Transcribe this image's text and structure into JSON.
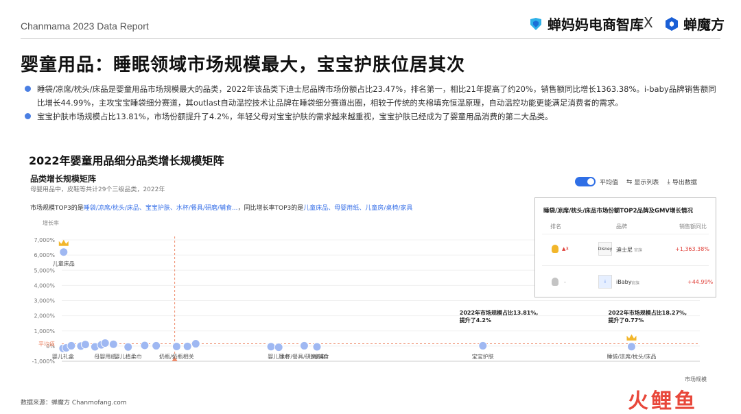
{
  "header": {
    "report_label": "Chanmama 2023 Data Report",
    "brand_left": "蝉妈妈电商智库",
    "brand_sep": "X",
    "brand_right": "蝉魔方"
  },
  "page_title": "婴童用品：睡眠领域市场规模最大，宝宝护肤位居其次",
  "bullets": [
    "睡袋/凉席/枕头/床品是婴童用品市场规模最大的品类，2022年该品类下迪士尼品牌市场份额占比23.47%，排名第一，相比21年提高了约20%，销售额同比增长1363.38%。i-baby品牌销售额同比增长44.99%，主攻宝宝睡袋细分赛道，其outlast自动温控技术让品牌在睡袋细分赛道出圈，相较于传统的夹棉填充恒温原理，自动温控功能更能满足消费者的需求。",
    "宝宝护肤市场规模占比13.81%，市场份额提升了4.2%，年轻父母对宝宝护肤的需求越来越重视，宝宝护肤已经成为了婴童用品消费的第二大品类。"
  ],
  "matrix_title": "2022年婴童用品细分品类增长规模矩阵",
  "panel": {
    "title": "品类增长规模矩阵",
    "subtitle": "母婴用品中，皮鞋等共计29个三级品类，2022年",
    "top3_prefix": "市场规模TOP3的是",
    "top3_market": "睡袋/凉席/枕头/床品、宝宝护肤、水杯/餐具/研磨/辅食...",
    "top3_middle": "，同比增长率TOP3的是",
    "top3_growth": "儿童床品、母婴用纸、儿童房/桌椅/家具"
  },
  "controls": {
    "toggle_label": "平均值",
    "list_label": "显示列表",
    "export_label": "导出数据"
  },
  "chart_data": {
    "type": "scatter",
    "ylabel": "增长率",
    "xlabel": "市场规模",
    "y_ticks": [
      "7,000%",
      "6,000%",
      "5,000%",
      "4,000%",
      "3,000%",
      "2,000%",
      "1,000%",
      "0%",
      "-1,000%"
    ],
    "ylim": [
      -1000,
      7000
    ],
    "xlim": [
      0,
      100
    ],
    "avg_label": "平均值",
    "avg_y": 150,
    "avg_x": 17.7,
    "series": [
      {
        "points": [
          {
            "x": 0.3,
            "y": 6200,
            "label": "儿童床品",
            "crown": true
          },
          {
            "x": 0.2,
            "y": -150,
            "label": "婴儿礼盒"
          },
          {
            "x": 0.7,
            "y": -120
          },
          {
            "x": 1.5,
            "y": 20
          },
          {
            "x": 3.0,
            "y": 0
          },
          {
            "x": 3.7,
            "y": 100
          },
          {
            "x": 5.2,
            "y": -50
          },
          {
            "x": 6.2,
            "y": 80
          },
          {
            "x": 6.8,
            "y": 200,
            "label": "母婴用纸"
          },
          {
            "x": 8.1,
            "y": 120
          },
          {
            "x": 10.4,
            "y": -60,
            "label": "婴儿植柔巾"
          },
          {
            "x": 13.0,
            "y": 40
          },
          {
            "x": 14.8,
            "y": 20
          },
          {
            "x": 18.0,
            "y": -30,
            "label": "奶瓶/奶瓶相关"
          },
          {
            "x": 19.7,
            "y": -20
          },
          {
            "x": 21.0,
            "y": 150
          },
          {
            "x": 32.8,
            "y": -40
          },
          {
            "x": 34.0,
            "y": -80,
            "label": "婴儿理巾"
          },
          {
            "x": 38.0,
            "y": 20,
            "label": "水杯/餐具/研磨/辅食"
          },
          {
            "x": 40.0,
            "y": -50,
            "label": "小家电"
          },
          {
            "x": 66.0,
            "y": 20,
            "label": "宝宝护肤"
          },
          {
            "x": 89.3,
            "y": -40,
            "label": "睡袋/凉席/枕头/床品",
            "crown": true
          }
        ]
      }
    ],
    "annotations": [
      {
        "x": 66.0,
        "line1": "2022年市场规模占比13.81%,",
        "line2": "提升了4.2%"
      },
      {
        "x": 89.3,
        "line1": "2022年市场规模占比18.27%,",
        "line2": "提升了0.77%"
      }
    ]
  },
  "table": {
    "title": "睡袋/凉席/枕头/床品市场份额TOP2品牌及GMV增长情况",
    "headers": [
      "排名",
      "品牌",
      "销售额同比"
    ],
    "rows": [
      {
        "rank_change": "3",
        "logo": "Disney",
        "brand": "迪士尼",
        "tag": "官旗",
        "growth": "+1,363.38%"
      },
      {
        "rank_change": "-",
        "logo": "i",
        "brand": "iBaby",
        "tag": "官旗",
        "growth": "+44.99%"
      }
    ]
  },
  "footer": {
    "source": "数据来源：蝉魔方 Chanmofang.com",
    "logo_text": "火鲤鱼"
  },
  "colors": {
    "dot": "#9fb8f2",
    "accent": "#2f6fe6",
    "avg_line": "#ee8a6a",
    "crown": "#f2b62b"
  }
}
